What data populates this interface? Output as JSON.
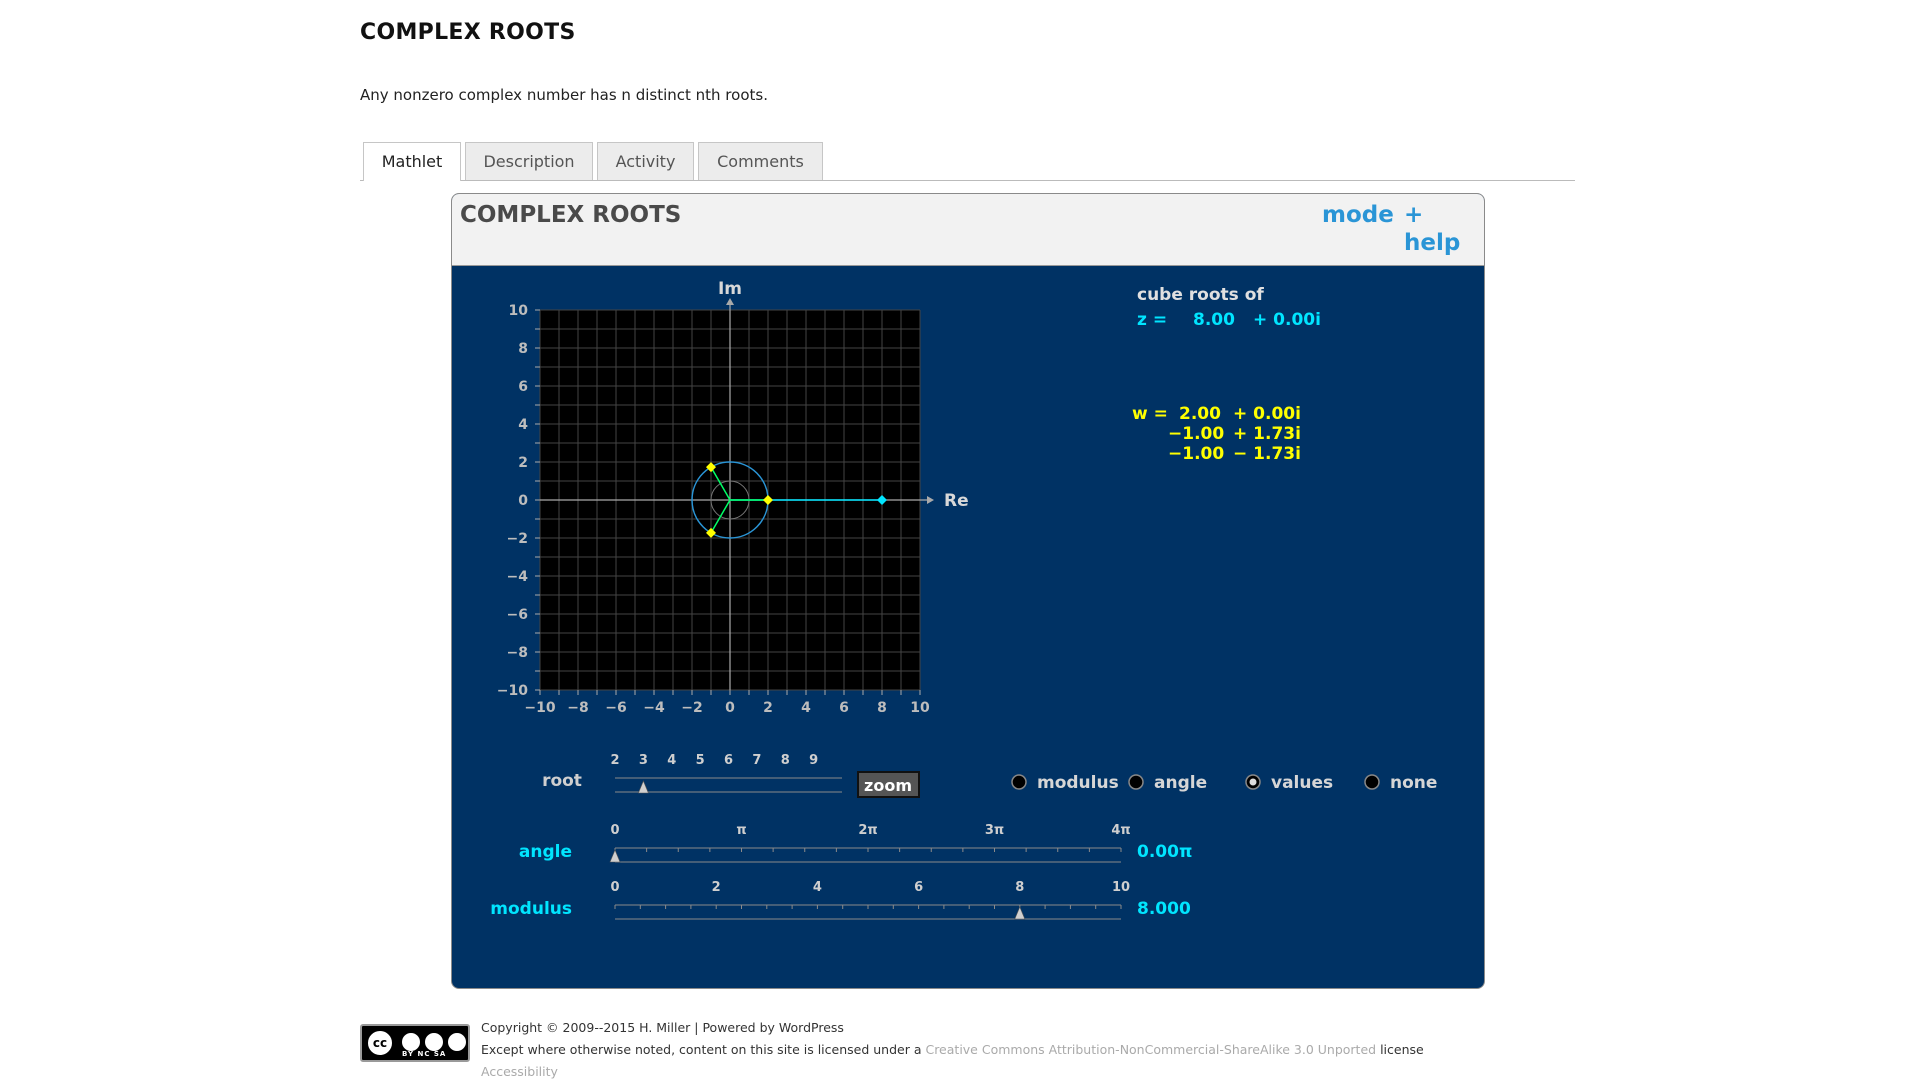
{
  "page": {
    "title": "COMPLEX ROOTS",
    "intro": "Any nonzero complex number has n distinct nth roots."
  },
  "tabs": [
    "Mathlet",
    "Description",
    "Activity",
    "Comments"
  ],
  "mathlet": {
    "title": "COMPLEX ROOTS",
    "mode_label": "mode",
    "plus_label": "+",
    "help_label": "help",
    "plot": {
      "re_label": "Re",
      "im_label": "Im",
      "xlim": [
        -10,
        10
      ],
      "ylim": [
        -10,
        10
      ],
      "x_ticks": [
        "−10",
        "−8",
        "−6",
        "−4",
        "−2",
        "0",
        "2",
        "4",
        "6",
        "8",
        "10"
      ],
      "y_ticks": [
        "10",
        "8",
        "6",
        "4",
        "2",
        "0",
        "−2",
        "−4",
        "−6",
        "−8",
        "−10"
      ],
      "z_point": [
        8.0,
        0.0
      ],
      "modulus_circle_r": 2.0,
      "roots": [
        [
          2.0,
          0.0
        ],
        [
          -1.0,
          1.73
        ],
        [
          -1.0,
          -1.73
        ]
      ],
      "colors": {
        "background": "#003264",
        "grid": "#444444",
        "axes": "#aaaaaa",
        "circle": "#2a95d6",
        "z": "#00e5ff",
        "roots": "#ffff00",
        "root_spokes": "#00ff66"
      }
    },
    "readout": {
      "cube_roots_of": "cube roots of",
      "z_prefix": "z =",
      "z_re": "8.00",
      "z_im": "+ 0.00i",
      "w_prefix": "w =",
      "w1_re": "2.00",
      "w1_im": "+ 0.00i",
      "w2_re": "−1.00",
      "w2_im": "+ 1.73i",
      "w3_re": "−1.00",
      "w3_im": "− 1.73i"
    },
    "root_slider": {
      "label": "root",
      "ticks": [
        "2",
        "3",
        "4",
        "5",
        "6",
        "7",
        "8",
        "9"
      ],
      "value": 3
    },
    "zoom_label": "zoom",
    "display_options": {
      "options": [
        "modulus",
        "angle",
        "values",
        "none"
      ],
      "selected": "values"
    },
    "angle_slider": {
      "label": "angle",
      "ticks": [
        "0",
        "π",
        "2π",
        "3π",
        "4π"
      ],
      "value_text": "0.00π",
      "value_fraction": 0.0
    },
    "modulus_slider": {
      "label": "modulus",
      "ticks": [
        "0",
        "2",
        "4",
        "6",
        "8",
        "10"
      ],
      "value_text": "8.000",
      "value": 8.0,
      "range": [
        0,
        10
      ]
    }
  },
  "footer": {
    "copyright": "Copyright © 2009--2015 H. Miller | Powered by WordPress",
    "license_prefix": "Except where otherwise noted, content on this site is licensed under a",
    "license_link": "Creative Commons Attribution-NonCommercial-ShareAlike 3.0 Unported",
    "license_suffix": "license",
    "accessibility": "Accessibility",
    "badge_cc": "cc",
    "badge_text": "BY NC SA"
  }
}
